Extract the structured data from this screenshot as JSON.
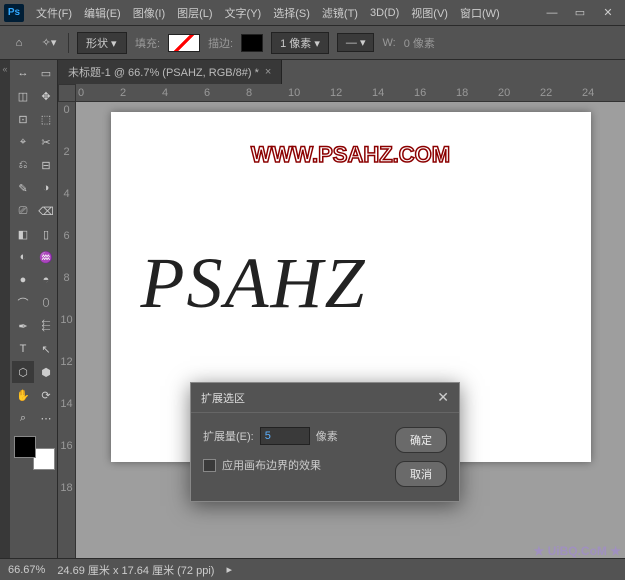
{
  "menubar": {
    "items": [
      "文件(F)",
      "编辑(E)",
      "图像(I)",
      "图层(L)",
      "文字(Y)",
      "选择(S)",
      "滤镜(T)",
      "3D(D)",
      "视图(V)",
      "窗口(W)"
    ]
  },
  "toolbar": {
    "shape_label": "形状",
    "fill_label": "填充:",
    "stroke_label": "描边:",
    "stroke_width": "1 像素",
    "w_label": "W:",
    "w_value": "0 像素"
  },
  "doc_tab": {
    "title": "未标题-1 @ 66.7% (PSAHZ, RGB/8#) *"
  },
  "ruler_h": [
    "0",
    "2",
    "4",
    "6",
    "8",
    "10",
    "12",
    "14",
    "16",
    "18",
    "20",
    "22",
    "24"
  ],
  "ruler_v": [
    "0",
    "2",
    "4",
    "6",
    "8",
    "10",
    "12",
    "14",
    "16",
    "18"
  ],
  "canvas": {
    "watermark_top": "WWW.PSAHZ.COM",
    "script_text": "PSAHZ",
    "watermark_bottom": "★ UiBQ.CoM ★"
  },
  "dialog": {
    "title": "扩展选区",
    "expand_label": "扩展量(E):",
    "expand_value": "5",
    "unit": "像素",
    "checkbox_label": "应用画布边界的效果",
    "ok": "确定",
    "cancel": "取消"
  },
  "statusbar": {
    "zoom": "66.67%",
    "dims": "24.69 厘米 x 17.64 厘米 (72 ppi)"
  },
  "tool_icons": [
    "↔",
    "▭",
    "◫",
    "✥",
    "⊡",
    "⬚",
    "⌖",
    "✂",
    "⎌",
    "⊟",
    "✎",
    "◑",
    "⎚",
    "⌫",
    "◧",
    "▯",
    "◐",
    "♒",
    "●",
    "◓",
    "⌒",
    "⬯",
    "✒",
    "⬱",
    "T",
    "↖",
    "⬡",
    "⬢",
    "✋",
    "⟳",
    "⌕",
    "⋯"
  ]
}
